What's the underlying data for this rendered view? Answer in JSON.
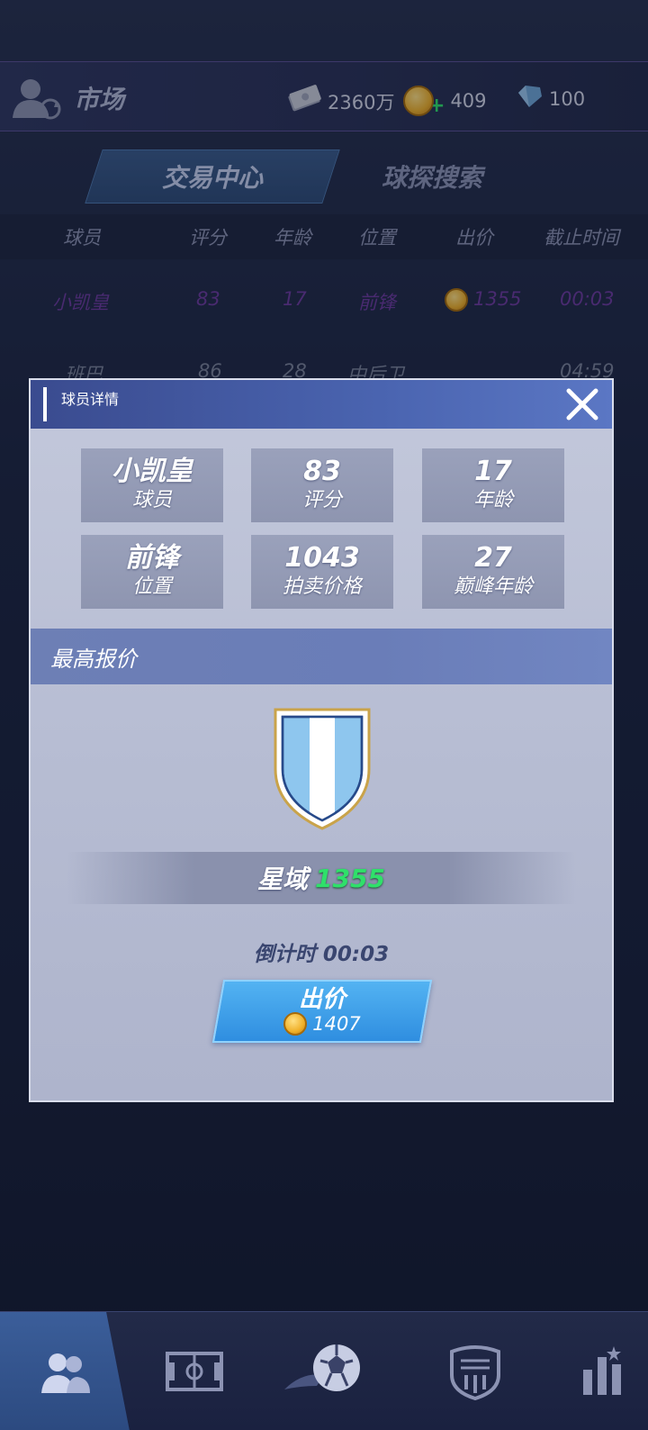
{
  "topbar": {
    "title": "市场",
    "cash": "2360万",
    "coins": "409",
    "gems": "100"
  },
  "tabs": [
    {
      "label": "交易中心",
      "active": true
    },
    {
      "label": "球探搜索",
      "active": false
    }
  ],
  "table": {
    "headers": [
      "球员",
      "评分",
      "年龄",
      "位置",
      "出价",
      "截止时间"
    ],
    "rows": [
      {
        "name": "小凯皇",
        "rating": "83",
        "age": "17",
        "position": "前锋",
        "price": "1355",
        "time": "00:03"
      },
      {
        "name": "班巴",
        "rating": "86",
        "age": "28",
        "position": "中后卫",
        "price": "",
        "time": "04:59"
      }
    ]
  },
  "modal": {
    "title": "球员详情",
    "stats": [
      {
        "value": "小凯皇",
        "label": "球员"
      },
      {
        "value": "83",
        "label": "评分"
      },
      {
        "value": "17",
        "label": "年龄"
      },
      {
        "value": "前锋",
        "label": "位置"
      },
      {
        "value": "1043",
        "label": "拍卖价格"
      },
      {
        "value": "27",
        "label": "巅峰年龄"
      }
    ],
    "section_title": "最高报价",
    "bidder": {
      "name": "星域",
      "price": "1355"
    },
    "countdown": "倒计时 00:03",
    "bid_button": {
      "label": "出价",
      "cost": "1407"
    }
  },
  "nav": [
    {
      "icon": "players-icon",
      "active": true
    },
    {
      "icon": "pitch-icon",
      "active": false
    },
    {
      "icon": "match-ball-icon",
      "active": false
    },
    {
      "icon": "club-badge-icon",
      "active": false
    },
    {
      "icon": "stats-icon",
      "active": false
    }
  ],
  "colors": {
    "accent_blue": "#2f8ee0",
    "bidder_price_green": "#2fe06a",
    "highlight_row_purple": "#6c3a9d"
  }
}
